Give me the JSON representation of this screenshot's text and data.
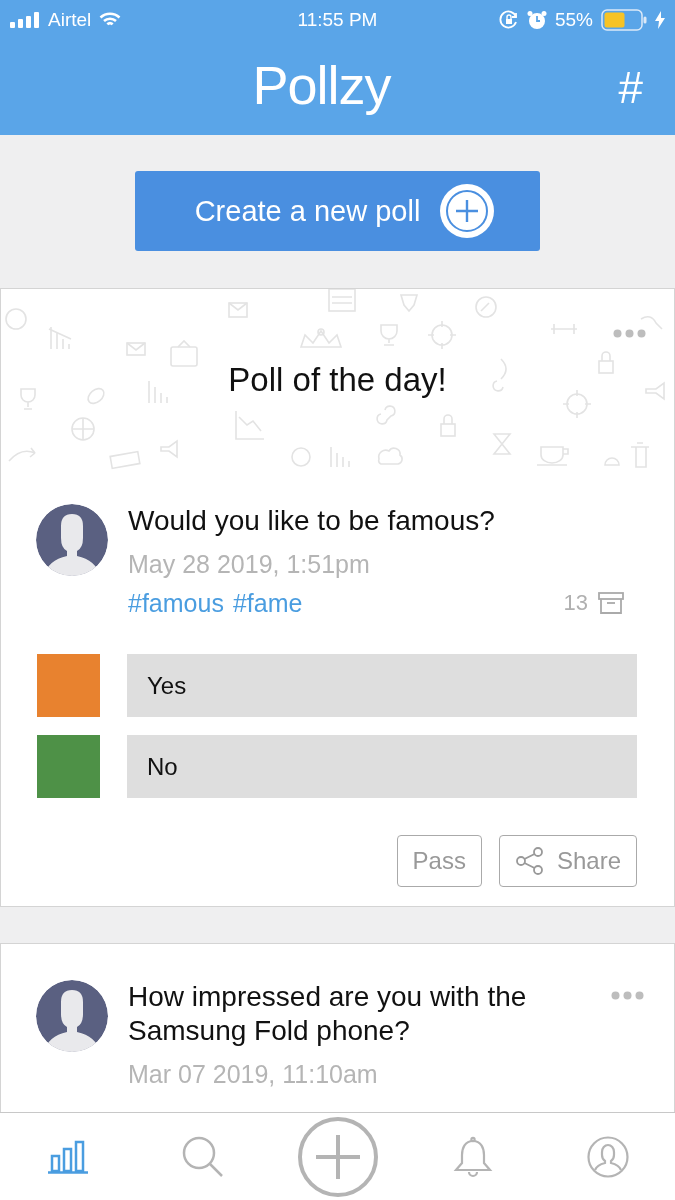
{
  "status_bar": {
    "carrier": "Airtel",
    "time": "11:55 PM",
    "battery": "55%"
  },
  "header": {
    "logo": "Pollzy",
    "hashtag_button": "#"
  },
  "create_button": {
    "label": "Create a new poll"
  },
  "polls": [
    {
      "banner": "Poll of the day!",
      "question": "Would you like to be famous?",
      "date": "May 28 2019, 1:51pm",
      "hashtags": [
        "#famous",
        "#fame"
      ],
      "count": "13",
      "options": [
        {
          "label": "Yes",
          "color": "#e8822f"
        },
        {
          "label": "No",
          "color": "#4e9147"
        }
      ],
      "actions": [
        {
          "kind": "pass",
          "label": "Pass"
        },
        {
          "kind": "share",
          "label": "Share"
        }
      ]
    },
    {
      "question": "How impressed are you with the Samsung Fold phone?",
      "date": "Mar 07 2019, 11:10am"
    }
  ],
  "tab_bar": [
    {
      "kind": "stats",
      "selected": true
    },
    {
      "kind": "search",
      "selected": false
    },
    {
      "kind": "add",
      "selected": false
    },
    {
      "kind": "notifications",
      "selected": false
    },
    {
      "kind": "profile",
      "selected": false
    }
  ]
}
